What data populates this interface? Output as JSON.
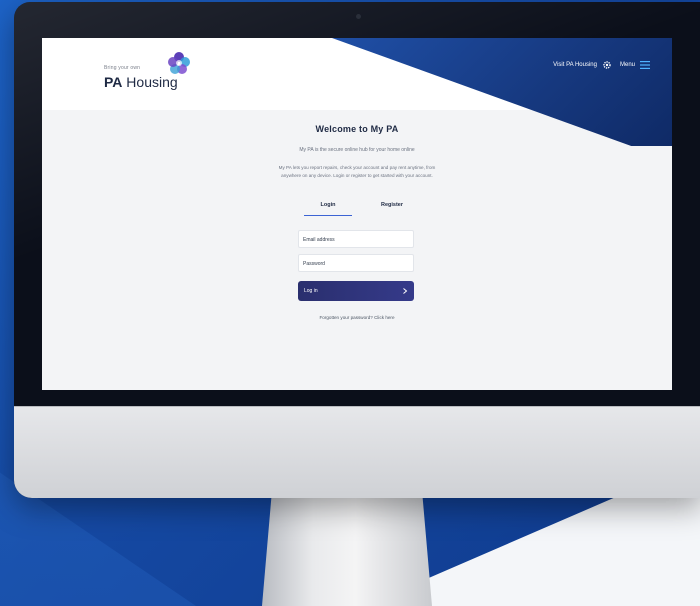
{
  "site": {
    "logo_tagline": "Bring your own",
    "logo_name_bold": "PA",
    "logo_name_light": " Housing",
    "nav_visit": "Visit PA Housing",
    "nav_menu": "Menu"
  },
  "page": {
    "title": "Welcome to My PA",
    "intro": "My PA is the secure online hub for your home online",
    "desc_line1": "My PA lets you report repairs, check your account and pay rent anytime, from",
    "desc_line2": "anywhere on any device. Login or register to get started with your account."
  },
  "tabs": [
    {
      "label": "Login"
    },
    {
      "label": "Register"
    }
  ],
  "form": {
    "email_placeholder": "Email address",
    "password_placeholder": "Password",
    "login_label": "Log in",
    "forgot_text": "Forgotten your password? Click here"
  },
  "colors": {
    "brand_navy": "#2a2f6e",
    "header_blue": "#1f4fa6",
    "accent": "#3b63d4"
  },
  "icons": {
    "logo": "flower-logo-icon",
    "settings": "gear-icon",
    "menu": "hamburger-menu-icon",
    "login_arrow": "chevron-right-icon"
  }
}
